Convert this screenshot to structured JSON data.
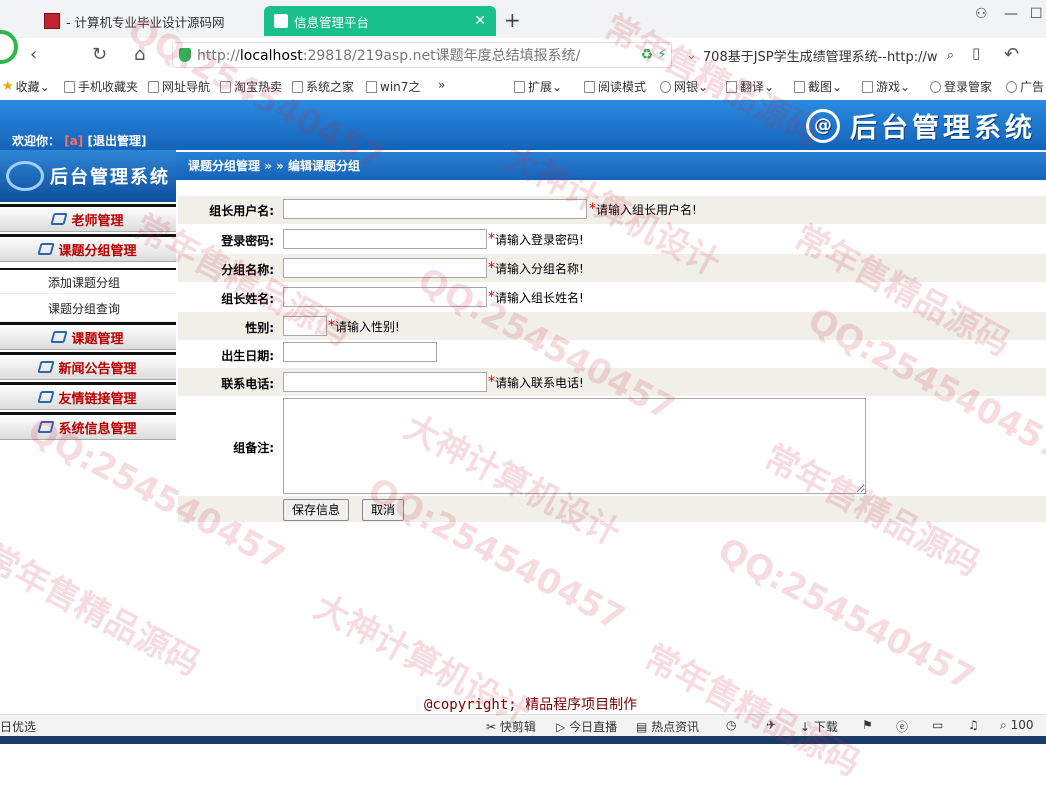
{
  "browser": {
    "tabs": [
      {
        "title": "- 计算机专业毕业设计源码网"
      },
      {
        "title": "信息管理平台"
      }
    ],
    "new_tab": "+",
    "url_host": "localhost",
    "url_prefix": "http://",
    "url_rest": ":29818/219asp.net课题年度总结填报系统/",
    "search_text": "708基于JSP学生成绩管理系统--http://w",
    "bookmarks": [
      "收藏",
      "手机收藏夹",
      "网址导航",
      "淘宝热卖",
      "系统之家",
      "win7之",
      "»",
      "扩展",
      "阅读模式",
      "网银",
      "翻译",
      "截图",
      "游戏",
      "登录管家",
      "广告"
    ]
  },
  "header": {
    "logo_text": "后台管理系统",
    "welcome_label": "欢迎你：",
    "user_name": "[a]",
    "logout": "[退出管理]"
  },
  "sidebar": {
    "logo_text": "后台管理系统",
    "menus": [
      {
        "label": "老师管理"
      },
      {
        "label": "课题分组管理"
      },
      {
        "label": "课题管理"
      },
      {
        "label": "新闻公告管理"
      },
      {
        "label": "友情链接管理"
      },
      {
        "label": "系统信息管理"
      }
    ],
    "submenu": [
      "添加课题分组",
      "课题分组查询"
    ]
  },
  "breadcrumb": "课题分组管理 » » 编辑课题分组",
  "form": {
    "fields": [
      {
        "label": "组长用户名:",
        "value": "",
        "hint": "请输入组长用户名!"
      },
      {
        "label": "登录密码:",
        "value": "",
        "hint": "请输入登录密码!"
      },
      {
        "label": "分组名称:",
        "value": "",
        "hint": "请输入分组名称!"
      },
      {
        "label": "组长姓名:",
        "value": "",
        "hint": "请输入组长姓名!"
      },
      {
        "label": "性别:",
        "value": "",
        "hint": "请输入性别!"
      },
      {
        "label": "出生日期:",
        "value": ""
      },
      {
        "label": "联系电话:",
        "value": "",
        "hint": "请输入联系电话!"
      },
      {
        "label": "组备注:",
        "value": ""
      }
    ],
    "required_mark": "*",
    "save_label": "保存信息",
    "cancel_label": "取消"
  },
  "footer": {
    "copyright": "@copyright; 精品程序项目制作"
  },
  "statusbar": {
    "left": "日优选",
    "items": [
      "快剪辑",
      "今日直播",
      "热点资讯",
      "下载",
      "100"
    ]
  },
  "watermarks": [
    "QQ:254540457",
    "常年售精品源码",
    "大神计算机设计"
  ],
  "colors": {
    "accent_blue": "#1564b9",
    "menu_red": "#b80000",
    "active_tab": "#19c08a"
  }
}
